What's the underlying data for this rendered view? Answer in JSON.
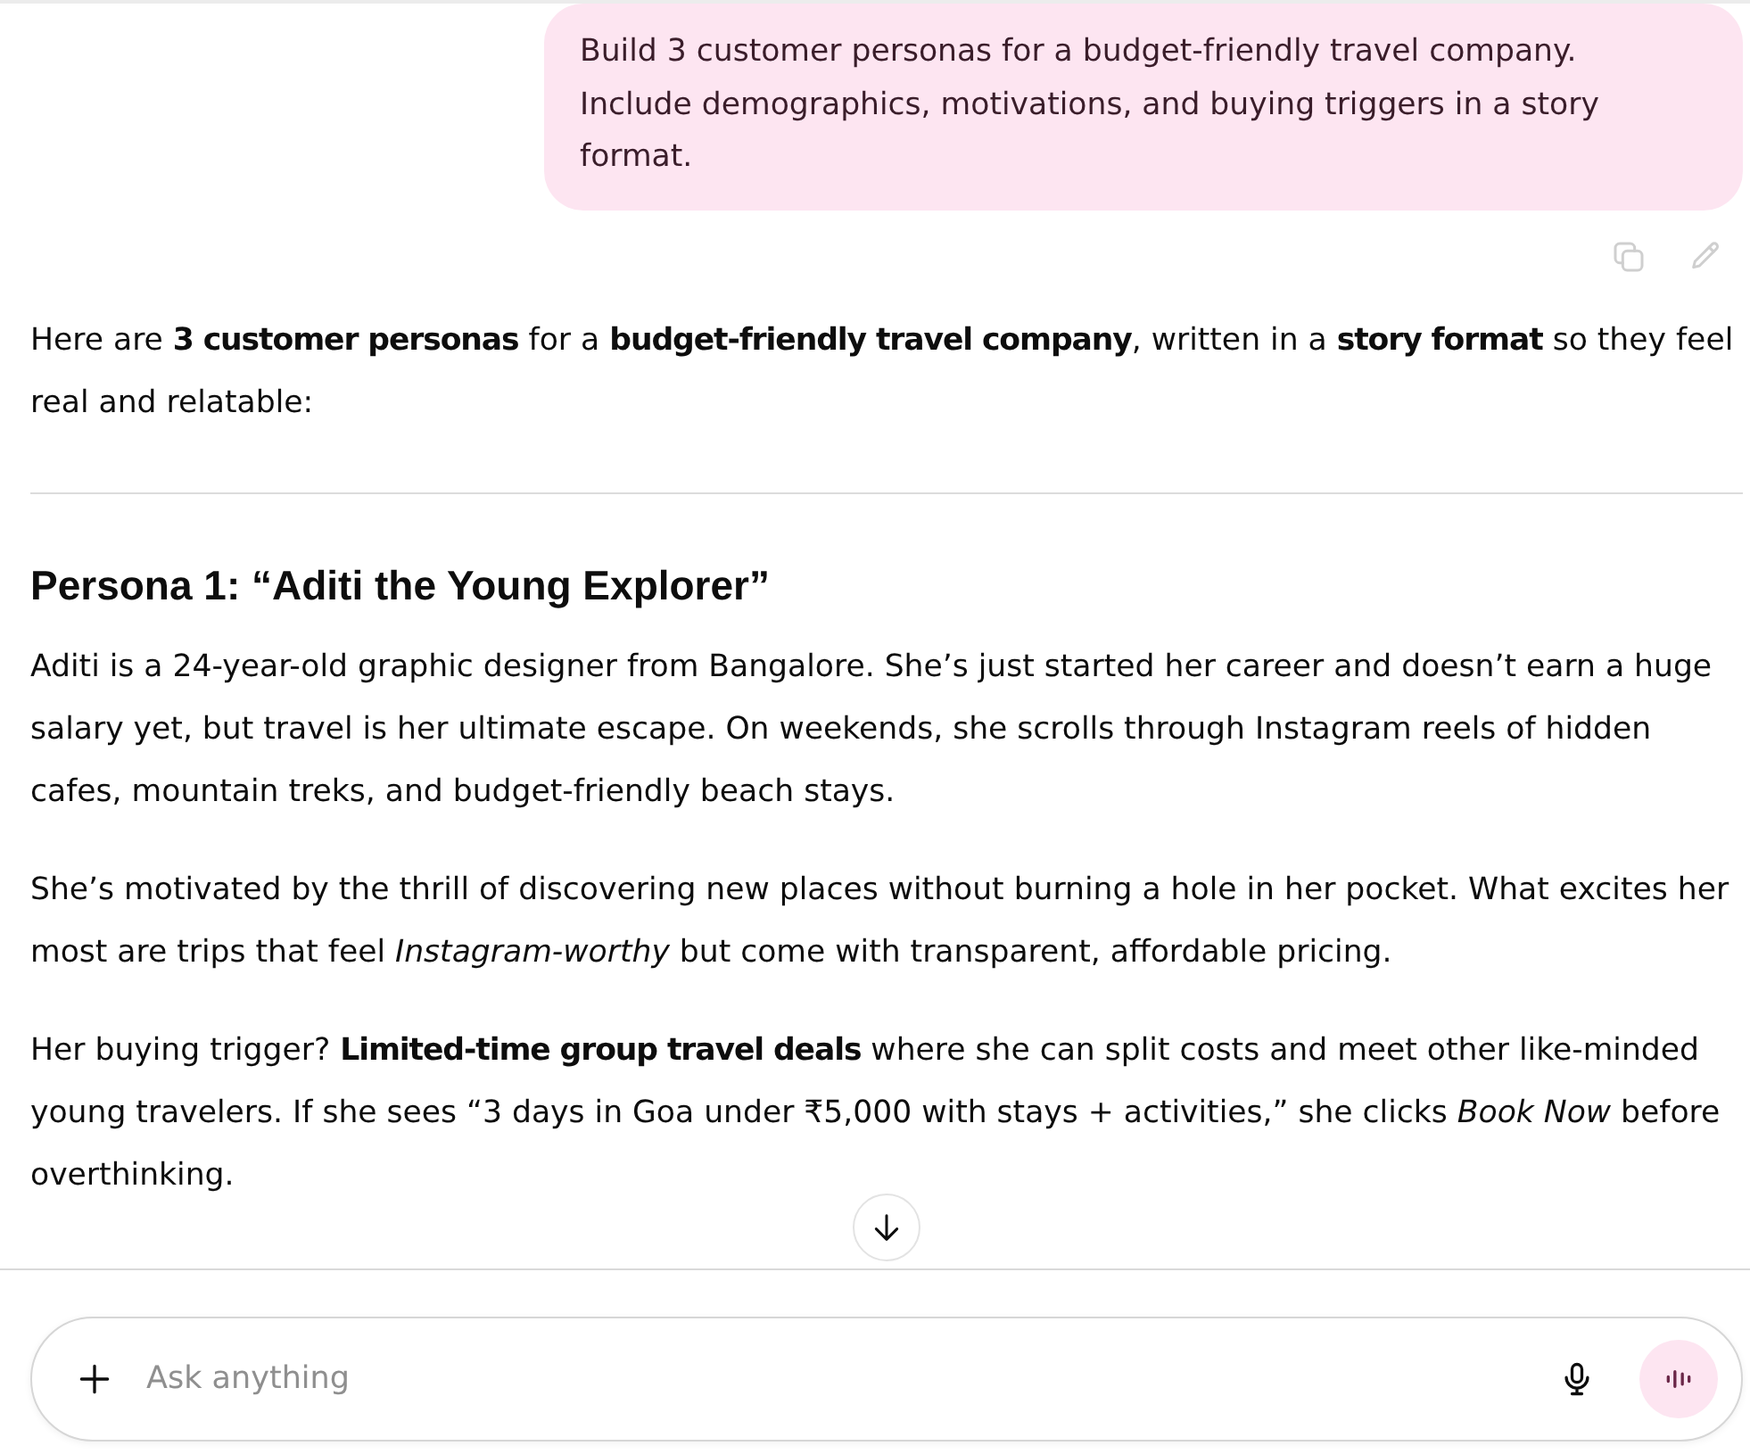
{
  "user_message": {
    "text": "Build 3 customer personas for a budget-friendly travel company. Include demographics, motivations, and buying triggers in a story format."
  },
  "response": {
    "intro": "Here are **3 customer personas** for a **budget-friendly travel company**, written in a **story format** so they feel real and relatable:",
    "sections": [
      {
        "heading": "Persona 1: “Aditi the Young Explorer”",
        "paragraphs": [
          "Aditi is a 24-year-old graphic designer from Bangalore. She’s just started her career and doesn’t earn a huge salary yet, but travel is her ultimate escape. On weekends, she scrolls through Instagram reels of hidden cafes, mountain treks, and budget-friendly beach stays.",
          "She’s motivated by the thrill of discovering new places without burning a hole in her pocket. What excites her most are trips that feel *Instagram-worthy* but come with transparent, affordable pricing.",
          "Her buying trigger? **Limited-time group travel deals** where she can split costs and meet other like-minded young travelers. If she sees “3 days in Goa under ₹5,000 with stays + activities,” she clicks *Book Now* before overthinking."
        ]
      }
    ]
  },
  "composer": {
    "placeholder": "Ask anything"
  }
}
